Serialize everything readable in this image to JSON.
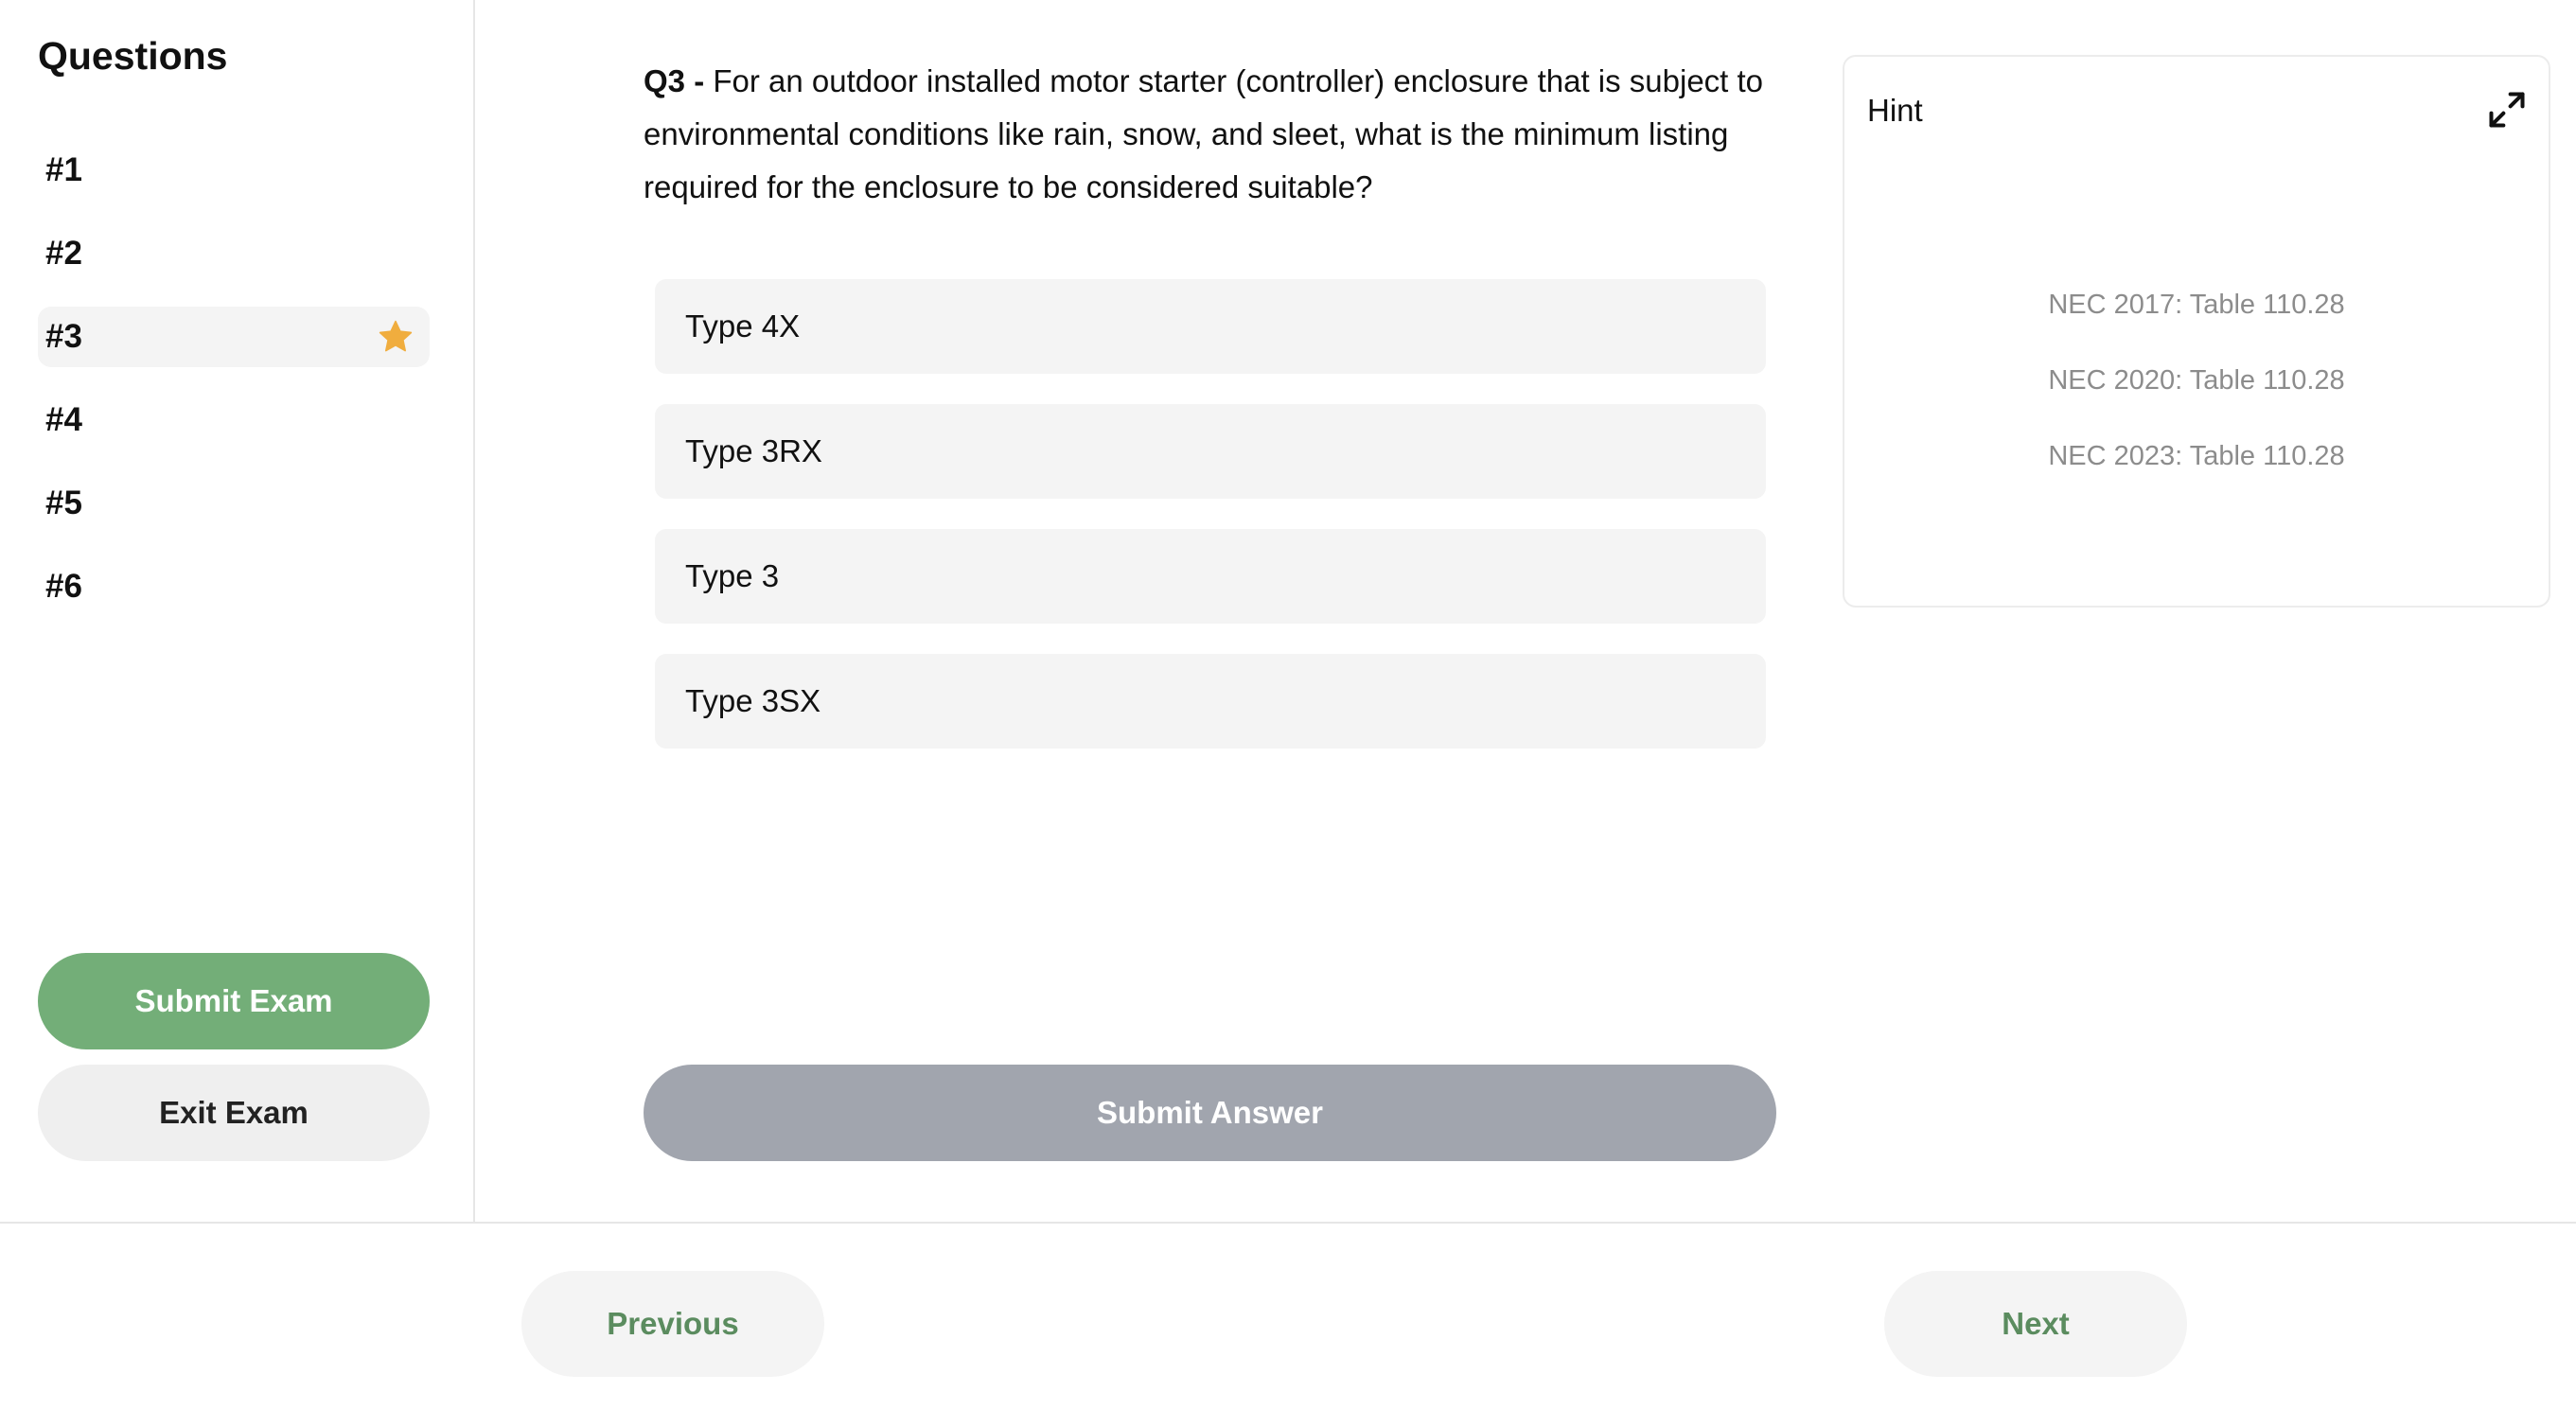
{
  "sidebar": {
    "title": "Questions",
    "items": [
      {
        "label": "#1",
        "active": false,
        "starred": false
      },
      {
        "label": "#2",
        "active": false,
        "starred": false
      },
      {
        "label": "#3",
        "active": true,
        "starred": true
      },
      {
        "label": "#4",
        "active": false,
        "starred": false
      },
      {
        "label": "#5",
        "active": false,
        "starred": false
      },
      {
        "label": "#6",
        "active": false,
        "starred": false
      }
    ],
    "star_icon": "star-icon",
    "star_color": "#f0ad3e",
    "submit_exam_label": "Submit Exam",
    "exit_exam_label": "Exit Exam"
  },
  "question": {
    "number_label": "Q3 -",
    "text": "For an outdoor installed motor starter (controller) enclosure that is subject to environmental conditions like rain, snow, and sleet, what is the minimum listing required for the enclosure to be considered suitable?",
    "answers": [
      "Type 4X",
      "Type 3RX",
      "Type 3",
      "Type 3SX"
    ],
    "submit_label": "Submit Answer"
  },
  "hint": {
    "title": "Hint",
    "expand_icon": "expand-icon",
    "references": [
      "NEC 2017: Table 110.28",
      "NEC 2020: Table 110.28",
      "NEC 2023: Table 110.28"
    ]
  },
  "footer": {
    "previous_label": "Previous",
    "next_label": "Next"
  },
  "colors": {
    "accent_green": "#73ae78",
    "nav_text_green": "#5b8c5f",
    "disabled_gray": "#a1a5ae"
  }
}
